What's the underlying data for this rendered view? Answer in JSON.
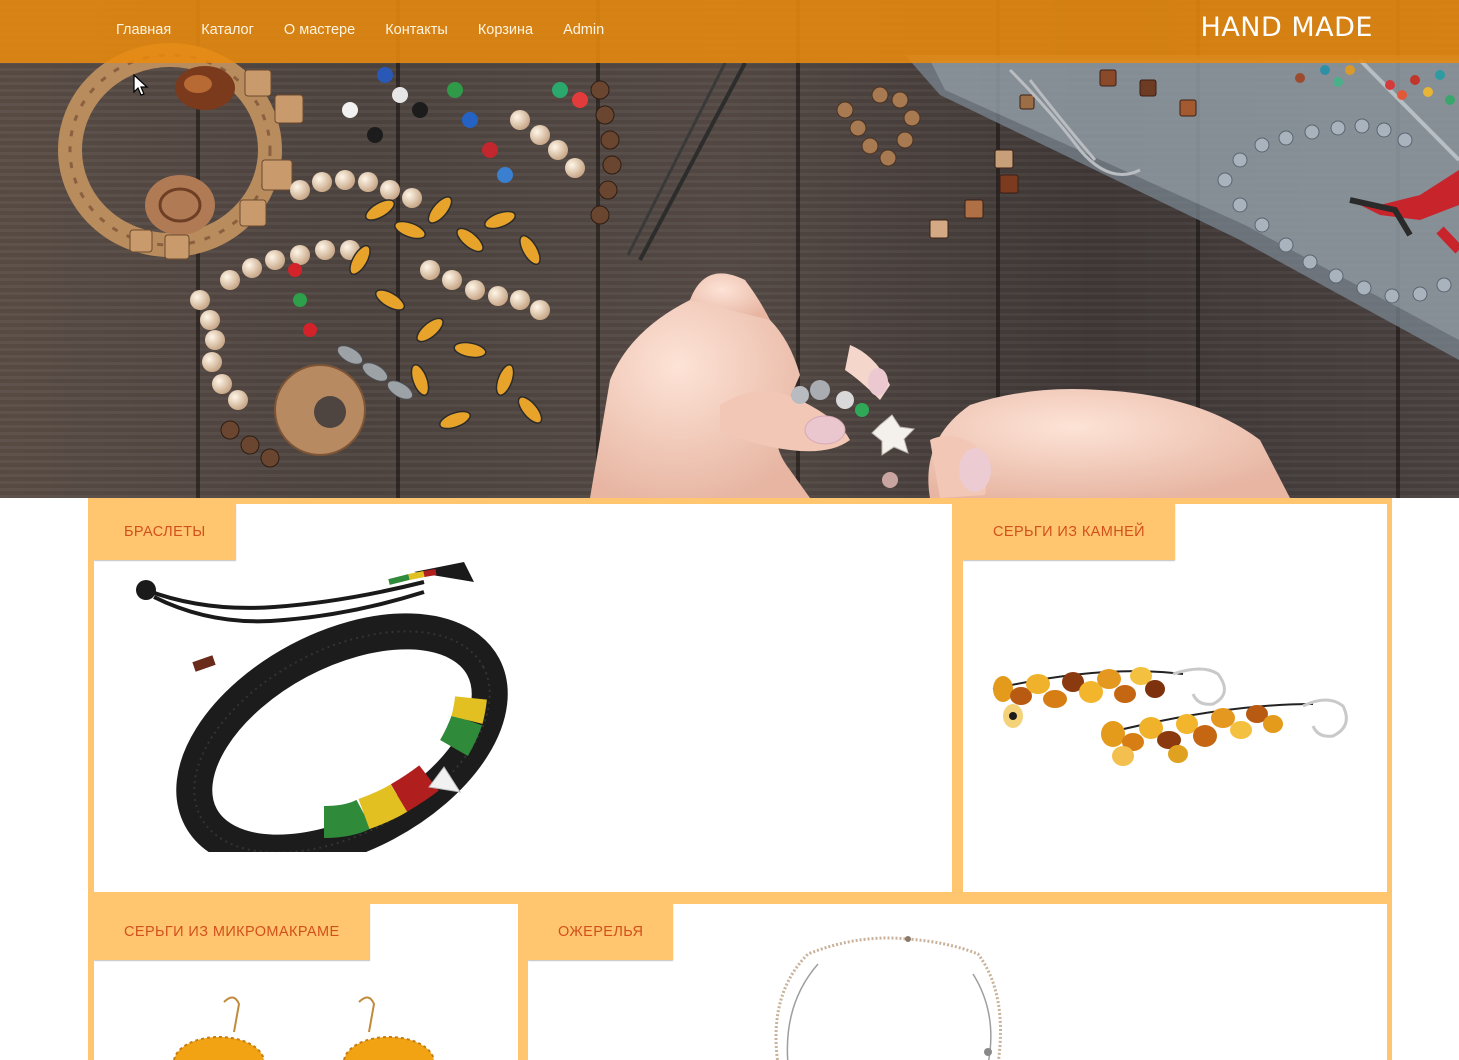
{
  "nav": {
    "items": [
      {
        "label": "Главная"
      },
      {
        "label": "Каталог"
      },
      {
        "label": "О мастере"
      },
      {
        "label": "Контакты"
      },
      {
        "label": "Корзина"
      },
      {
        "label": "Admin"
      }
    ],
    "brand": "HAND MADE"
  },
  "categories": [
    {
      "label": "БРАСЛЕТЫ"
    },
    {
      "label": "СЕРЬГИ ИЗ КАМНЕЙ"
    },
    {
      "label": "СЕРЬГИ ИЗ МИКРОМАКРАМЕ"
    },
    {
      "label": "ОЖЕРЕЛЬЯ"
    }
  ],
  "colors": {
    "nav_bg": "#e88a0e",
    "tile_border": "#ffc66f",
    "tag_text": "#d2501c"
  }
}
